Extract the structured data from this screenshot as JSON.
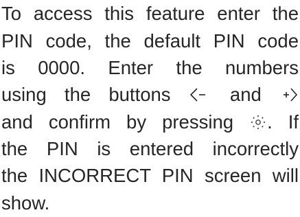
{
  "paragraph": {
    "line1": "To access this feature enter the",
    "line2": "PIN code, the default PIN code",
    "line3": "is 0000. Enter the numbers",
    "line4_before": "using the buttons",
    "line4_middle": "and",
    "line5_before": "and confirm by pressing",
    "line5_after": ". If",
    "line6": "the PIN is entered incorrectly",
    "line7": "the INCORRECT PIN screen will",
    "line8": "show."
  },
  "icons": {
    "left_button": "left-arrow-button-icon",
    "right_button": "right-arrow-button-icon",
    "confirm_button": "confirm-button-icon"
  },
  "colors": {
    "text": "#262626",
    "background": "#ffffff"
  }
}
